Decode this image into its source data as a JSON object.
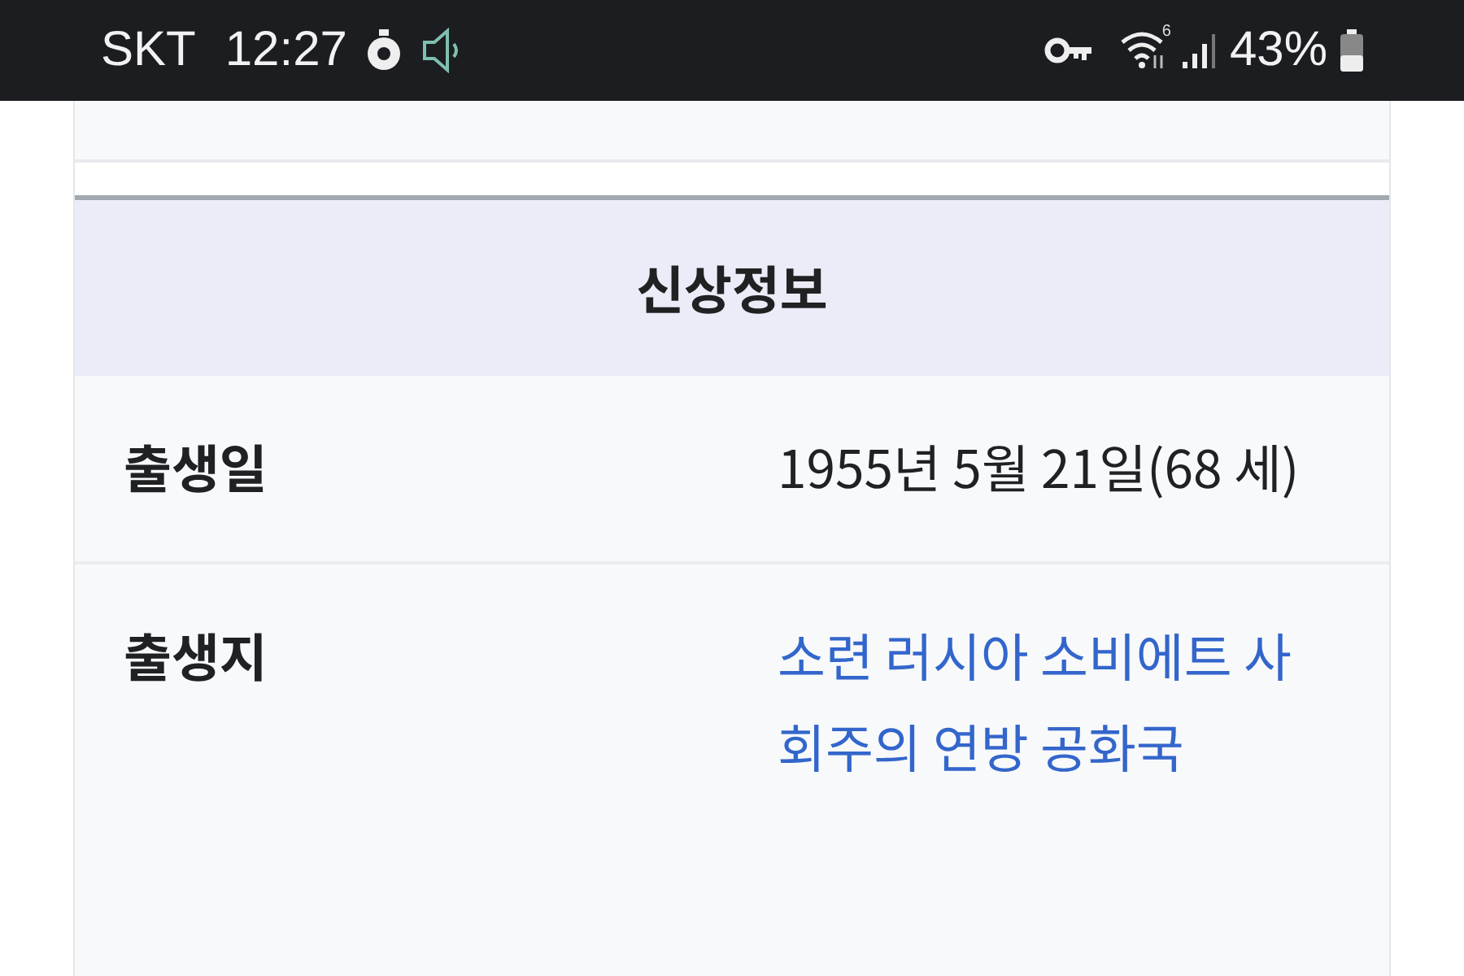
{
  "status_bar": {
    "carrier": "SKT",
    "time": "12:27",
    "wifi_badge": "6",
    "battery": "43%"
  },
  "infobox": {
    "title": "신상정보",
    "rows": [
      {
        "label": "출생일",
        "value": "1955년 5월 21일(68 세)",
        "kind": "text"
      },
      {
        "label": "출생지",
        "value": "소련 러시아 소비에트 사회주의 연방 공화국",
        "kind": "link"
      }
    ]
  }
}
